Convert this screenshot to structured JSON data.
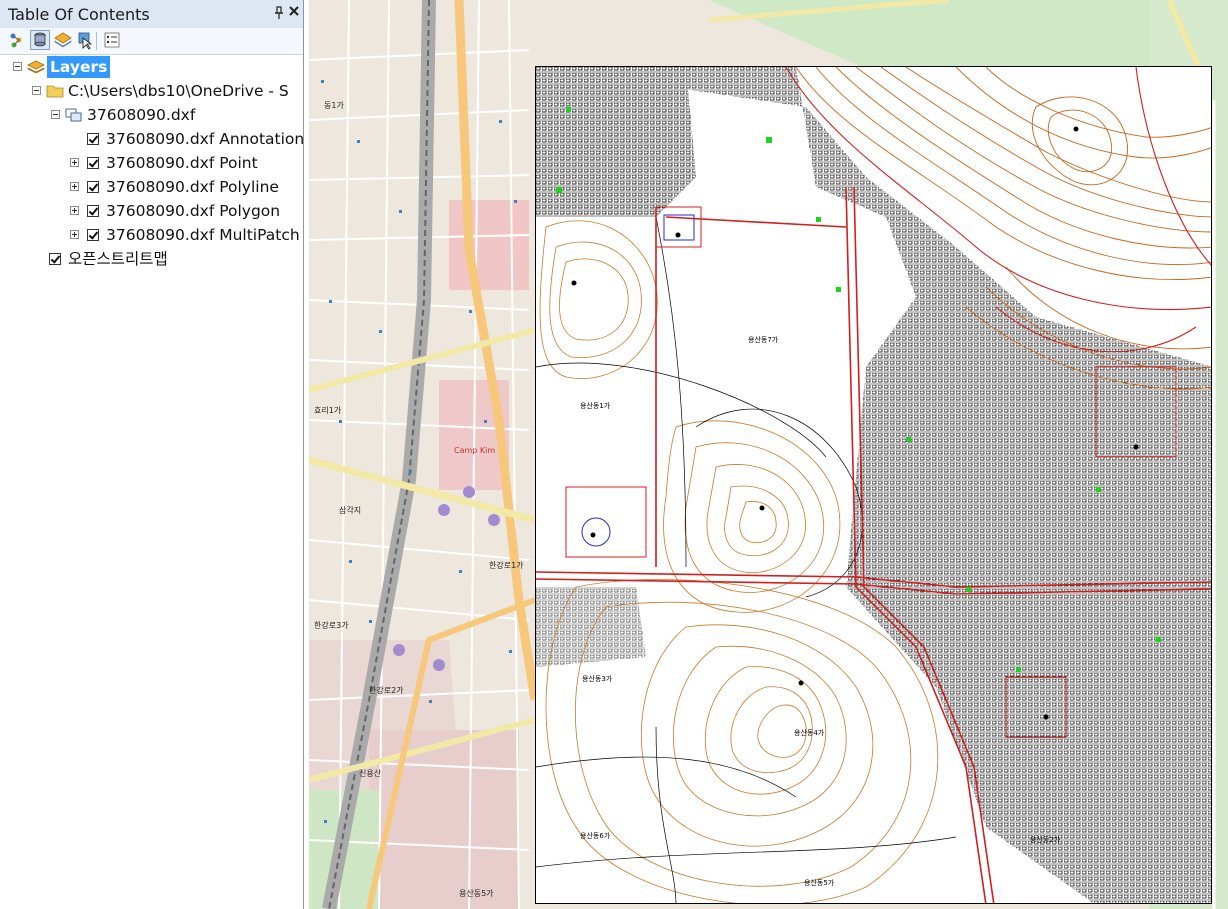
{
  "toc": {
    "title": "Table Of Contents",
    "pin_glyph": "ᚓ",
    "close_glyph": "✕",
    "tree": {
      "layers_label": "Layers",
      "folder_label": "C:\\Users\\dbs10\\OneDrive - S",
      "dxf_group_label": "37608090.dxf",
      "items": [
        {
          "label": "37608090.dxf Annotation"
        },
        {
          "label": "37608090.dxf Point"
        },
        {
          "label": "37608090.dxf Polyline"
        },
        {
          "label": "37608090.dxf Polygon"
        },
        {
          "label": "37608090.dxf MultiPatch"
        }
      ],
      "basemap_label": "오픈스트리트맵"
    }
  },
  "map": {
    "area_label": "Camp Kim",
    "street_labels": [
      "한강로2가",
      "한강로1가",
      "한강로3가",
      "동1가",
      "효리1가",
      "삼각지",
      "용산동5가",
      "신용산"
    ],
    "dxf_labels": [
      "용산동7가",
      "용산동1가",
      "용산동3가",
      "용산동4가",
      "용산동5가",
      "용산동6가",
      "용산동2가"
    ]
  }
}
